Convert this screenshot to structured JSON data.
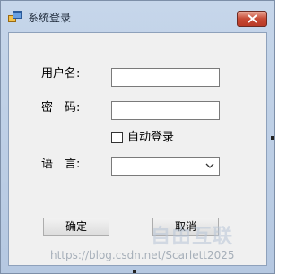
{
  "window": {
    "title": "系统登录",
    "accent": "#c74a35"
  },
  "form": {
    "username_label": "用户名:",
    "username_value": "",
    "password_label": "密　码:",
    "password_value": "",
    "auto_login_label": "自动登录",
    "auto_login_checked": false,
    "language_label": "语　言:",
    "language_selected": ""
  },
  "buttons": {
    "ok_label": "确定",
    "cancel_label": "取消"
  },
  "watermark": {
    "url_text": "https://blog.csdn.net/Scarlett2025",
    "logo_text": "自由互联"
  }
}
